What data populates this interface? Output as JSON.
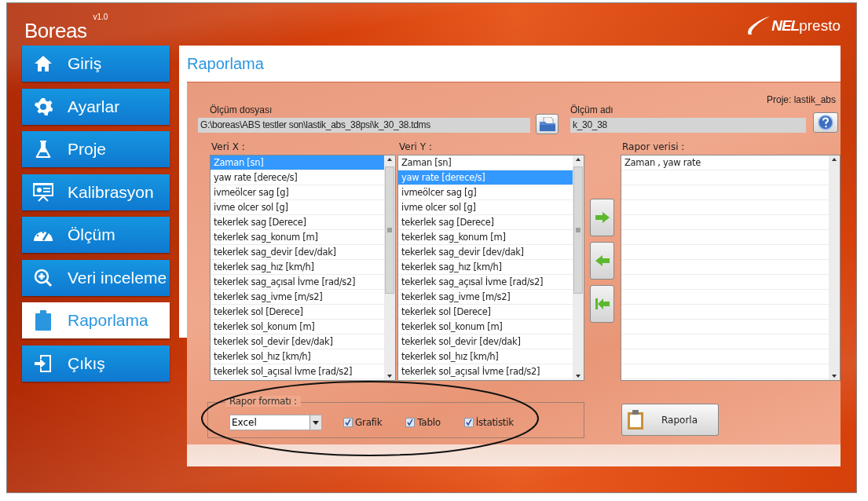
{
  "app": {
    "title": "Boreas",
    "version": "v1.0",
    "logo_bold": "NEL",
    "logo_text": "presto"
  },
  "sidebar": {
    "items": [
      {
        "label": "Giriş",
        "selected": false
      },
      {
        "label": "Ayarlar",
        "selected": false
      },
      {
        "label": "Proje",
        "selected": false
      },
      {
        "label": "Kalibrasyon",
        "selected": false
      },
      {
        "label": "Ölçüm",
        "selected": false
      },
      {
        "label": "Veri inceleme",
        "selected": false
      },
      {
        "label": "Raporlama",
        "selected": true
      },
      {
        "label": "Çıkış",
        "selected": false
      }
    ]
  },
  "page": {
    "title": "Raporlama",
    "file": {
      "label": "Ölçüm dosyası",
      "value": "G:\\boreas\\ABS testler son\\lastik_abs_38psi\\k_30_38.tdms"
    },
    "name": {
      "label": "Ölçüm adı",
      "value": "k_30_38"
    },
    "project": "Proje: lastik_abs",
    "lists": [
      {
        "label": "Veri X :",
        "items": [
          {
            "text": "Zaman [sn]",
            "selected": true
          },
          {
            "text": "yaw rate [derece/s]",
            "selected": false
          },
          {
            "text": "ivmeölcer sag [g]",
            "selected": false
          },
          {
            "text": "ivme olcer sol [g]",
            "selected": false
          },
          {
            "text": "tekerlek sag [Derece]",
            "selected": false
          },
          {
            "text": "tekerlek sag_konum [m]",
            "selected": false
          },
          {
            "text": "tekerlek sag_devir [dev/dak]",
            "selected": false
          },
          {
            "text": "tekerlek sag_hız [km/h]",
            "selected": false
          },
          {
            "text": "tekerlek sag_açısal İvme [rad/s2]",
            "selected": false
          },
          {
            "text": "tekerlek sag_ivme [m/s2]",
            "selected": false
          },
          {
            "text": "tekerlek sol [Derece]",
            "selected": false
          },
          {
            "text": "tekerlek sol_konum [m]",
            "selected": false
          },
          {
            "text": "tekerlek sol_devir [dev/dak]",
            "selected": false
          },
          {
            "text": "tekerlek sol_hız [km/h]",
            "selected": false
          },
          {
            "text": "tekerlek sol_açısal İvme [rad/s2]",
            "selected": false
          }
        ]
      },
      {
        "label": "Veri Y :",
        "items": [
          {
            "text": "Zaman [sn]",
            "selected": false
          },
          {
            "text": "yaw rate [derece/s]",
            "selected": true
          },
          {
            "text": "ivmeölcer sag [g]",
            "selected": false
          },
          {
            "text": "ivme olcer sol [g]",
            "selected": false
          },
          {
            "text": "tekerlek sag [Derece]",
            "selected": false
          },
          {
            "text": "tekerlek sag_konum [m]",
            "selected": false
          },
          {
            "text": "tekerlek sag_devir [dev/dak]",
            "selected": false
          },
          {
            "text": "tekerlek sag_hız [km/h]",
            "selected": false
          },
          {
            "text": "tekerlek sag_açısal İvme [rad/s2]",
            "selected": false
          },
          {
            "text": "tekerlek sag_ivme [m/s2]",
            "selected": false
          },
          {
            "text": "tekerlek sol [Derece]",
            "selected": false
          },
          {
            "text": "tekerlek sol_konum [m]",
            "selected": false
          },
          {
            "text": "tekerlek sol_devir [dev/dak]",
            "selected": false
          },
          {
            "text": "tekerlek sol_hız [km/h]",
            "selected": false
          },
          {
            "text": "tekerlek sol_açısal İvme [rad/s2]",
            "selected": false
          }
        ]
      }
    ],
    "report": {
      "label": "Rapor verisi :",
      "items": [
        {
          "text": "Zaman , yaw rate",
          "selected": false
        }
      ]
    },
    "format": {
      "label": "Rapor formatı :",
      "value": "Excel",
      "options": [
        {
          "label": "Grafik",
          "checked": true
        },
        {
          "label": "Tablo",
          "checked": true
        },
        {
          "label": "İstatistik",
          "checked": true
        }
      ]
    },
    "action": "Raporla"
  }
}
